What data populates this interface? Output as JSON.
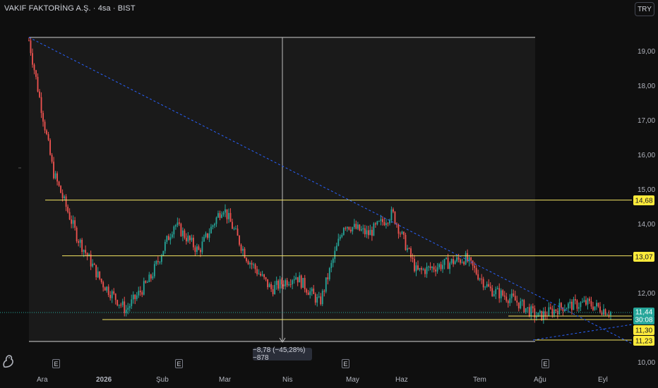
{
  "header": {
    "title": "VAKIF FAKTORİNG A.Ş. · 4sa · BIST",
    "currency_button": "TRY"
  },
  "price_axis": {
    "ticks": [
      "19,00",
      "18,00",
      "17,00",
      "16,00",
      "15,00",
      "14,00",
      "12,00",
      "10,00"
    ]
  },
  "time_axis": {
    "ticks": [
      "Ara",
      "2026",
      "Şub",
      "Mar",
      "Nis",
      "May",
      "Haz",
      "Tem",
      "Ağu",
      "Eyl"
    ]
  },
  "price_tags": {
    "level_1": "14,68",
    "level_2": "13,07",
    "last_price": "11,44",
    "countdown": "30:08",
    "level_3": "11,30",
    "level_4": "11,23"
  },
  "measure_label": "−8,78 (−45,28%) −878",
  "earnings_badges": [
    "E",
    "E",
    "E",
    "E"
  ],
  "colors": {
    "up": "#26a69a",
    "down": "#ef5350",
    "horizontal_level": "#f5e663",
    "trendline": "#2962ff",
    "last_price_bg": "#26a69a",
    "level_tag_bg": "#ffeb3b"
  },
  "chart_data": {
    "type": "candlestick",
    "title": "VAKIF FAKTORİNG A.Ş. · 4sa · BIST",
    "x": [
      "Ara",
      "2026",
      "Şub",
      "Mar",
      "Nis",
      "May",
      "Haz",
      "Tem",
      "Ağu",
      "Eyl"
    ],
    "close_path": [
      [
        "late Kas",
        19.3
      ],
      [
        "early Ara",
        15.5
      ],
      [
        "mid Ara",
        13.6
      ],
      [
        "late Ara",
        12.3
      ],
      [
        "2026",
        11.5
      ],
      [
        "mid Oca",
        12.4
      ],
      [
        "late Oca",
        14.0
      ],
      [
        "Şub",
        13.2
      ],
      [
        "mid Şub",
        14.5
      ],
      [
        "late Şub",
        13.0
      ],
      [
        "Mar",
        12.1
      ],
      [
        "mid Mar",
        12.5
      ],
      [
        "Nis",
        11.7
      ],
      [
        "mid Nis",
        14.0
      ],
      [
        "late Nis",
        13.7
      ],
      [
        "May",
        14.3
      ],
      [
        "mid May",
        12.6
      ],
      [
        "Haz",
        12.8
      ],
      [
        "mid Haz",
        13.0
      ],
      [
        "Tem",
        12.1
      ],
      [
        "mid Tem",
        11.8
      ],
      [
        "Ağu",
        11.3
      ],
      [
        "mid Ağu",
        11.6
      ],
      [
        "late Ağu",
        11.7
      ],
      [
        "Eyl",
        11.44
      ]
    ],
    "horizontal_levels": [
      14.68,
      13.07,
      11.3,
      11.23
    ],
    "last_price": 11.44,
    "ylim": [
      9.8,
      19.8
    ],
    "grid": false
  }
}
